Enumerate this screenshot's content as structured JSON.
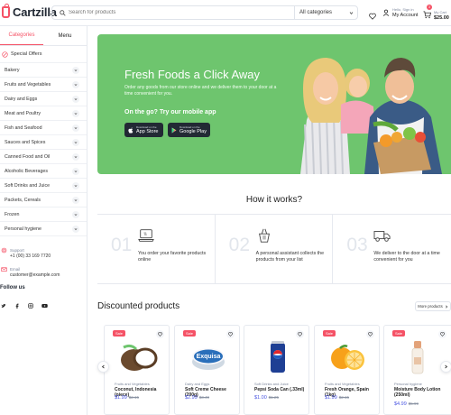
{
  "header": {
    "logo_text": "Cartzilla",
    "search_placeholder": "Search for products",
    "category_select": "All categories",
    "account_small": "Hello, Sign in",
    "account_big": "My Account",
    "cart_small": "My Cart",
    "cart_total": "$25.00",
    "cart_count": "3"
  },
  "sidebar": {
    "tabs": [
      "Categories",
      "Menu"
    ],
    "special": "Special Offers",
    "categories": [
      "Bakery",
      "Fruits and Vegetables",
      "Dairy and Eggs",
      "Meat and Poultry",
      "Fish and Seafood",
      "Sauces and Spices",
      "Canned Food and Oil",
      "Alcoholic Beverages",
      "Soft Drinks and Juice",
      "Packets, Cereals",
      "Frozen",
      "Personal hygiene"
    ],
    "support_label": "Support",
    "support_phone": "+1 (00) 33 169 7720",
    "email_label": "Email",
    "email_value": "customer@example.com",
    "follow": "Follow us"
  },
  "hero": {
    "title": "Fresh Foods a Click Away",
    "subtitle": "Order any goods from our store online and we deliver them to your door at a time convenient for you.",
    "cta": "On the go? Try our mobile app",
    "appstore_small": "Download on the",
    "appstore_big": "App Store",
    "google_small": "Download on the",
    "google_big": "Google Play",
    "bg_color": "#6ec56e"
  },
  "how": {
    "title": "How it works?",
    "steps": [
      {
        "num": "01",
        "text": "You order your favorite products online"
      },
      {
        "num": "02",
        "text": "A personal assistant collects the products from your list"
      },
      {
        "num": "03",
        "text": "We deliver to the door at a time convenient for you"
      }
    ]
  },
  "discounted": {
    "title": "Discounted products",
    "more": "More products",
    "products": [
      {
        "badge": "Sale",
        "category": "Fruits and Vegetables",
        "name": "Coconut, Indonesia (piece)",
        "price": "$1.99",
        "old": "$2.15"
      },
      {
        "badge": "Sale",
        "category": "Dairy and Eggs",
        "name": "Soft Creme Cheese (200g)",
        "price": "$2.99",
        "old": "$3.49"
      },
      {
        "badge": "",
        "category": "Soft Drinks and Juice",
        "name": "Pepsi Soda Can (.33ml)",
        "price": "$1.00",
        "old": "$1.25"
      },
      {
        "badge": "Sale",
        "category": "Fruits and Vegetables",
        "name": "Fresh Orange, Spain (1kg)",
        "price": "$1.99",
        "old": "$2.15"
      },
      {
        "badge": "Sale",
        "category": "Personal hygiene",
        "name": "Moisture Body Lotion (250ml)",
        "price": "$4.99",
        "old": "$5.99"
      }
    ]
  },
  "colors": {
    "accent": "#f55266",
    "price": "#4a56e2"
  }
}
